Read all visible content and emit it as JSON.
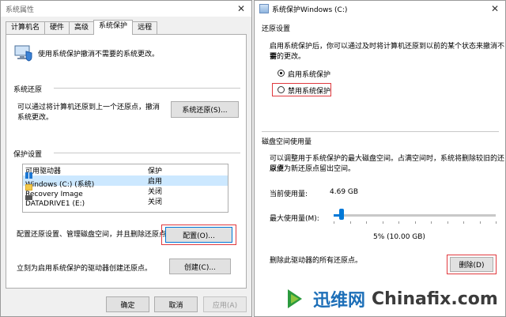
{
  "left_window": {
    "title": "系统属性",
    "close_glyph": "✕",
    "tabs": [
      "计算机名",
      "硬件",
      "高级",
      "系统保护",
      "远程"
    ],
    "intro_text": "使用系统保护撤消不需要的系统更改。",
    "restore": {
      "heading": "系统还原",
      "desc_line1": "可以通过将计算机还原到上一个还原点，撤消",
      "desc_line2": "系统更改。",
      "button": "系统还原(S)..."
    },
    "protection": {
      "heading": "保护设置",
      "columns": [
        "可用驱动器",
        "保护"
      ],
      "drives": [
        {
          "name": "Windows (C:) (系统)",
          "status": "启用",
          "icon": "windows-drive-icon"
        },
        {
          "name": "Recovery Image",
          "status": "关闭",
          "icon": "folder-icon"
        },
        {
          "name": "DATADRIVE1 (E:)",
          "status": "关闭",
          "icon": "usb-drive-icon"
        }
      ],
      "configure_text": "配置还原设置、管理磁盘空间，并且删除还原点。",
      "configure_button": "配置(O)...",
      "create_text": "立刻为启用系统保护的驱动器创建还原点。",
      "create_button": "创建(C)..."
    },
    "footer": {
      "ok": "确定",
      "cancel": "取消",
      "apply": "应用(A)"
    }
  },
  "right_window": {
    "title": "系统保护Windows (C:)",
    "close_glyph": "✕",
    "restore_settings": {
      "heading": "还原设置",
      "desc_line1": "启用系统保护后，你可以通过及时将计算机还原到以前的某个状态来撤消不需",
      "desc_line2": "要的更改。",
      "option_enable": "启用系统保护",
      "option_disable": "禁用系统保护",
      "selected": "enable"
    },
    "disk_usage": {
      "heading": "磁盘空间使用量",
      "desc_line1": "可以调整用于系统保护的最大磁盘空间。占满空间时，系统将删除较旧的还原点",
      "desc_line2": "以便为新还原点留出空间。",
      "current_label": "当前使用量:",
      "current_value": "4.69 GB",
      "max_label": "最大使用量(M):",
      "slider_fraction": 0.05,
      "max_value": "5% (10.00 GB)",
      "delete_text": "删除此驱动器的所有还原点。",
      "delete_button": "删除(D)"
    }
  },
  "watermark": {
    "cn": "迅维网",
    "en": "Chinafix.com"
  },
  "colors": {
    "accent": "#0078d7",
    "highlight_box": "#e0393e",
    "selected_row": "#cce8ff"
  }
}
